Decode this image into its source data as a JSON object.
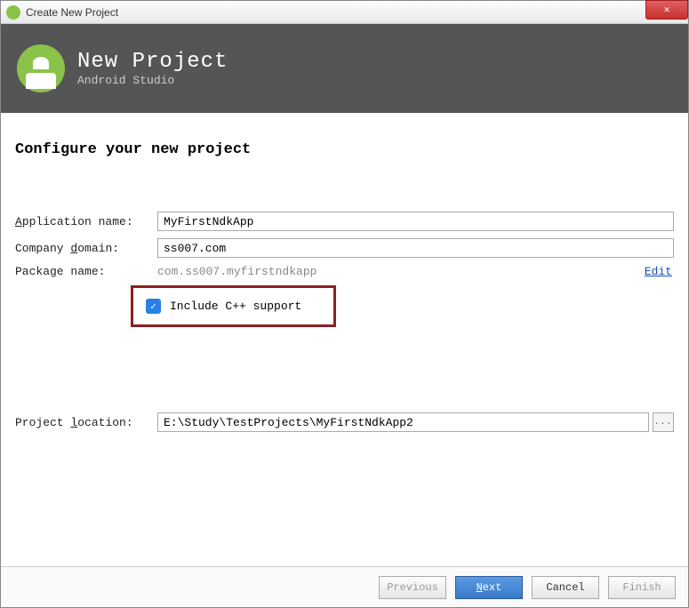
{
  "window": {
    "title": "Create New Project"
  },
  "header": {
    "title": "New Project",
    "subtitle": "Android Studio"
  },
  "section_title": "Configure your new project",
  "fields": {
    "app_name_label": "Application name:",
    "app_name_value": "MyFirstNdkApp",
    "company_label": "Company domain:",
    "company_value": "ss007.com",
    "package_label": "Package name:",
    "package_value": "com.ss007.myfirstndkapp",
    "edit_link": "Edit",
    "cpp_label": "Include C++ support",
    "cpp_checked": true,
    "location_label": "Project location:",
    "location_value": "E:\\Study\\TestProjects\\MyFirstNdkApp2",
    "browse_label": "..."
  },
  "buttons": {
    "previous": "Previous",
    "next": "Next",
    "cancel": "Cancel",
    "finish": "Finish"
  }
}
